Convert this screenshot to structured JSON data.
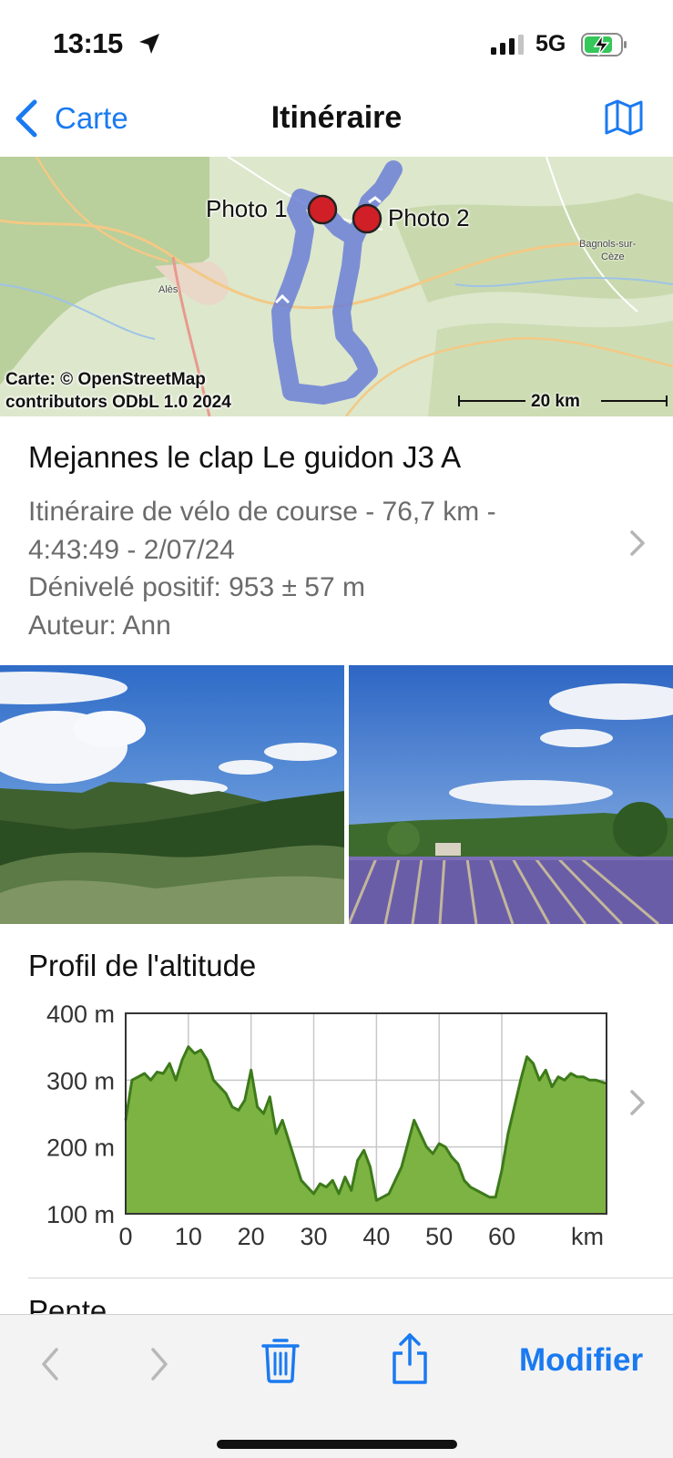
{
  "status_bar": {
    "time": "13:15",
    "network": "5G",
    "icons": [
      "location-arrow-icon",
      "signal-bars-icon",
      "battery-charging-icon"
    ]
  },
  "nav": {
    "back_label": "Carte",
    "title": "Itinéraire",
    "map_button_icon": "map-icon"
  },
  "map": {
    "photo_labels": [
      "Photo 1",
      "Photo 2"
    ],
    "towns": [
      "Alès",
      "Bagnols-sur-",
      "Cèze"
    ],
    "attribution_line1": "Carte: © OpenStreetMap",
    "attribution_line2": "contributors ODbL 1.0 2024",
    "scale": "20 km",
    "route_color": "#6b7fd6",
    "marker_color": "#d01f26"
  },
  "route": {
    "title": "Mejannes le clap Le guidon J3 A",
    "line1": "Itinéraire de vélo de course - 76,7 km -",
    "line2": "4:43:49 - 2/07/24",
    "line3": "Dénivelé positif: 953 ± 57 m",
    "line4": "Auteur: Ann"
  },
  "photos": [
    {
      "name": "photo-1",
      "description_icon": "landscape-hills"
    },
    {
      "name": "photo-2",
      "description_icon": "landscape-lavender"
    }
  ],
  "altitude": {
    "heading": "Profil de l'altitude",
    "y_ticks": [
      "400 m",
      "300 m",
      "200 m",
      "100 m"
    ],
    "x_ticks": [
      "0",
      "10",
      "20",
      "30",
      "40",
      "50",
      "60",
      "km"
    ]
  },
  "chart_data": {
    "type": "area",
    "title": "Profil de l'altitude",
    "xlabel": "km",
    "ylabel": "",
    "xlim": [
      0,
      76.7
    ],
    "ylim": [
      100,
      400
    ],
    "x_ticks": [
      0,
      10,
      20,
      30,
      40,
      50,
      60
    ],
    "y_ticks": [
      100,
      200,
      300,
      400
    ],
    "grid": true,
    "fill_color": "#7cb342",
    "line_color": "#3d7a1a",
    "x": [
      0,
      1,
      2,
      3,
      4,
      5,
      6,
      7,
      8,
      9,
      10,
      11,
      12,
      13,
      14,
      15,
      16,
      17,
      18,
      19,
      20,
      21,
      22,
      23,
      24,
      25,
      26,
      27,
      28,
      29,
      30,
      31,
      32,
      33,
      34,
      35,
      36,
      37,
      38,
      39,
      40,
      41,
      42,
      43,
      44,
      45,
      46,
      47,
      48,
      49,
      50,
      51,
      52,
      53,
      54,
      55,
      56,
      57,
      58,
      59,
      60,
      61,
      62,
      63,
      64,
      65,
      66,
      67,
      68,
      69,
      70,
      71,
      72,
      73,
      74,
      75,
      76.7
    ],
    "y": [
      240,
      300,
      305,
      310,
      300,
      312,
      310,
      325,
      300,
      330,
      350,
      340,
      345,
      330,
      300,
      290,
      280,
      260,
      255,
      270,
      315,
      260,
      250,
      275,
      220,
      240,
      210,
      180,
      150,
      140,
      130,
      145,
      140,
      150,
      130,
      155,
      135,
      180,
      195,
      170,
      120,
      125,
      130,
      150,
      170,
      205,
      240,
      220,
      200,
      190,
      205,
      200,
      185,
      175,
      150,
      140,
      135,
      130,
      125,
      125,
      165,
      220,
      260,
      300,
      335,
      325,
      300,
      315,
      290,
      305,
      300,
      310,
      305,
      305,
      300,
      300,
      295
    ]
  },
  "next_section_heading": "Pente",
  "toolbar": {
    "back_icon": "chevron-left-icon",
    "forward_icon": "chevron-right-icon",
    "delete_icon": "trash-icon",
    "share_icon": "share-icon",
    "modify_label": "Modifier"
  }
}
